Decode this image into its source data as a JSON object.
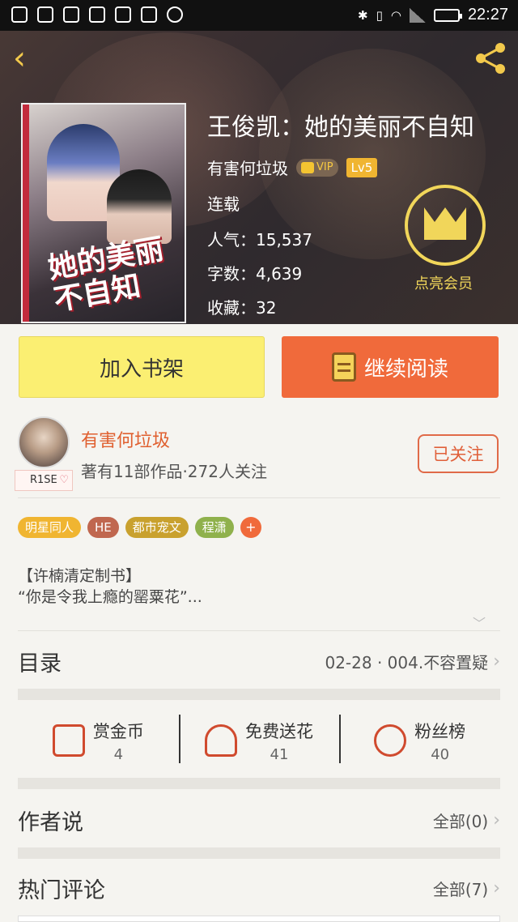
{
  "status_bar": {
    "time": "22:27"
  },
  "header": {
    "title": "王俊凯：她的美丽不自知",
    "author": "有害何垃圾",
    "vip_label": "VIP",
    "level": "Lv5",
    "status": "连载",
    "popularity": "人气：15,537",
    "words": "字数：4,639",
    "favorites": "收藏：32",
    "member_label": "点亮会员"
  },
  "cover": {
    "title_text": "她的美丽不自知"
  },
  "actions": {
    "add_shelf": "加入书架",
    "continue_read": "继续阅读"
  },
  "author_block": {
    "name": "有害何垃圾",
    "meta": "著有11部作品·272人关注",
    "avatar_tag": "R1SE",
    "follow_label": "已关注"
  },
  "tags": [
    {
      "label": "明星同人",
      "color": "#f0b531"
    },
    {
      "label": "HE",
      "color": "#c0674f"
    },
    {
      "label": "都市宠文",
      "color": "#c9a12e"
    },
    {
      "label": "程潇",
      "color": "#8fb14c"
    }
  ],
  "tag_more": "+",
  "description": {
    "line1": "【许楠清定制书】",
    "line2": "“你是令我上瘾的罂粟花”..."
  },
  "catalog": {
    "label": "目录",
    "value": "02-28 · 004.不容置疑"
  },
  "stats": [
    {
      "label": "赏金币",
      "value": "4",
      "icon": "red-envelope-icon"
    },
    {
      "label": "免费送花",
      "value": "41",
      "icon": "flower-icon"
    },
    {
      "label": "粉丝榜",
      "value": "40",
      "icon": "medal-icon"
    }
  ],
  "author_says": {
    "label": "作者说",
    "value": "全部(0)"
  },
  "hot_comments": {
    "label": "热门评论",
    "value": "全部(7)"
  },
  "colors": {
    "accent": "#f06a3b",
    "shelf": "#fbef72",
    "gold": "#f1d65a"
  }
}
